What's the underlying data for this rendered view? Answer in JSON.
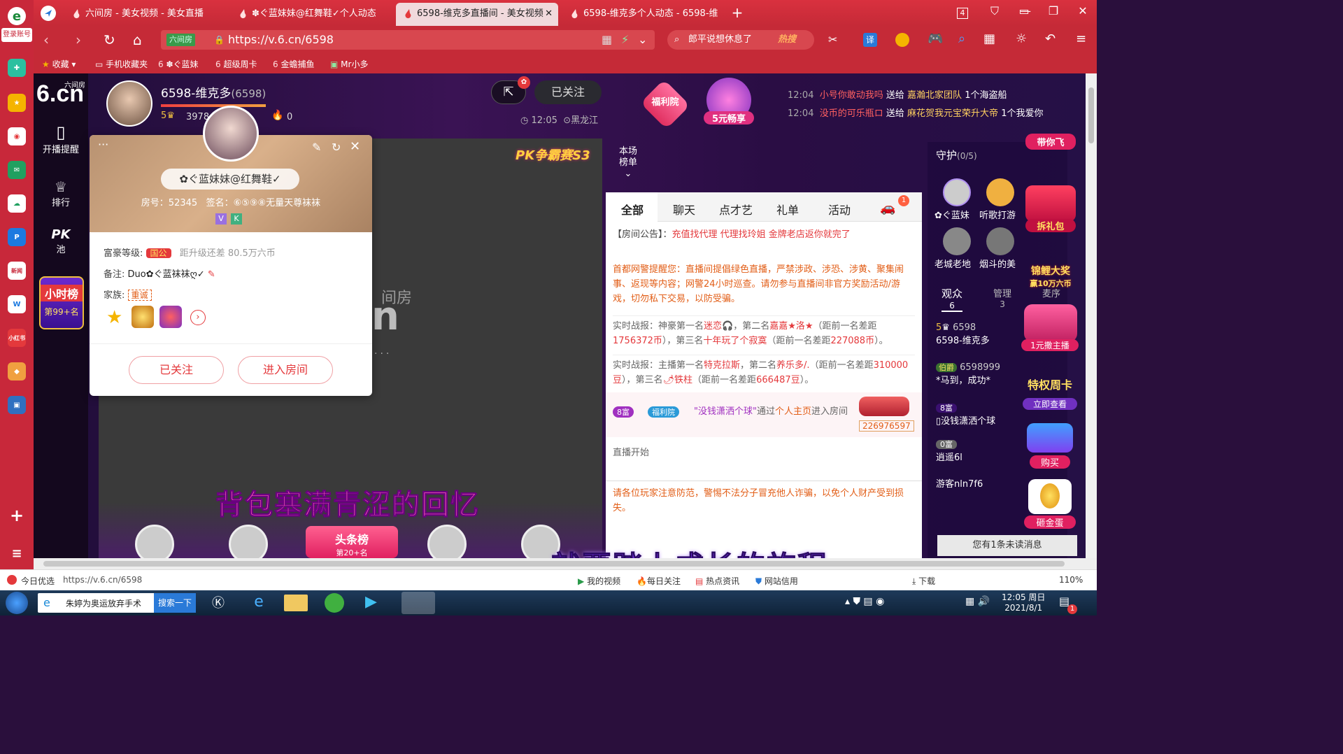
{
  "browser": {
    "login_label": "登录账号",
    "tabs": [
      {
        "title": "六间房 - 美女视频 - 美女直播"
      },
      {
        "title": "✽ぐ蓝妹妹@红舞鞋✓个人动态"
      },
      {
        "title": "6598-维克多直播间 - 美女视频"
      },
      {
        "title": "6598-维克多个人动态 - 6598-维"
      }
    ],
    "tab_count": "4",
    "site_chip": "六间房",
    "url": "https://v.6.cn/6598",
    "search_text": "郎平说想休息了",
    "hot_label": "热搜",
    "translate_label": "译",
    "bookmarks": [
      "收藏",
      "手机收藏夹",
      "✽ぐ蓝妹",
      "超级周卡",
      "金蟾捕鱼",
      "Mr小多"
    ]
  },
  "site": {
    "logo_small": "六间房",
    "logo_big": "6.cn",
    "left_nav": [
      {
        "label": "开播提醒"
      },
      {
        "label": "排行"
      },
      {
        "label": "池"
      }
    ],
    "pk_label": "PK",
    "hour_rank": {
      "title": "小时榜",
      "rank": "第99+名"
    },
    "anchor": {
      "name": "6598-维克多",
      "id": "(6598)",
      "level": "5",
      "fans": "3978",
      "fire": "0",
      "follow_label": "已关注",
      "time": "12:05",
      "location": "黑龙江"
    },
    "promos": {
      "fuli": "福利院",
      "five": "5元畅享"
    },
    "ticker": [
      {
        "time": "12:04",
        "from": "小号你敢动我吗",
        "action": "送给",
        "to": "嘉瀚北家团队",
        "gift": "1个海盗船"
      },
      {
        "time": "12:04",
        "from": "没币的可乐瓶ロ",
        "action": "送给",
        "to": "麻花贺我元宝荣升大帝",
        "gift": "1个我爱你"
      }
    ],
    "pk_banner": "PK争霸赛S3",
    "rank_tag": "本场\n榜单",
    "video": {
      "logo_text_a": "间房",
      "logo_text_b": "n",
      "dots": "...",
      "subtitle": "背包塞满青涩的回忆",
      "top_badge": "头条榜",
      "top_badge_rank": "第20+名"
    },
    "chat_tabs": [
      "全部",
      "聊天",
      "点才艺",
      "礼单",
      "活动"
    ],
    "car_badge": "1",
    "announcement": {
      "label": "【房间公告】：",
      "text": "充值找代理 代理找玲姐 金牌老店返你就完了"
    },
    "police": "首都网警提醒您：直播间提倡绿色直播，严禁涉政、涉恐、涉黄、聚集闹事、返现等内容；网警24小时巡查。请勿参与直播间非官方奖励活动/游戏，切勿私下交易，以防受骗。",
    "report1": {
      "p1": "实时战报：神豪第一名",
      "n1": "迷恋🎧",
      "p2": "，第二名",
      "n2": "嘉嘉★洛★",
      "p3": "（距前一名差距",
      "v1": "1756372币",
      "p4": "），第三名",
      "n3": "十年玩了个寂寞",
      "p5": "（距前一名差距",
      "v2": "227088币",
      "p6": "）。"
    },
    "report2": {
      "p1": "实时战报：主播第一名",
      "n1": "特克拉斯",
      "p2": "，第二名",
      "n2": "养乐多/.",
      "p3": "（距前一名差距",
      "v1": "310000豆",
      "p4": "），第三名",
      "n3": "🌶铁柱",
      "p5": "（距前一名差距",
      "v2": "666487豆",
      "p6": "）。"
    },
    "entry": {
      "level": "8富",
      "badge": "福利院",
      "name": "\"没钱潇洒个球\"",
      "via": "通过",
      "src": "个人主页",
      "action": "进入房间",
      "num": "226976597"
    },
    "live_start": "直播开始",
    "warning": "请各位玩家注意防范，警惕不法分子冒充他人诈骗，以免个人财产受到损失。",
    "guard": {
      "title": "守护",
      "count": "(0/5)",
      "members": [
        "✿ぐ蓝妹",
        "听歌打游",
        "老城老地",
        "烟斗的美"
      ],
      "audience_label": "观众",
      "audience_count": "6",
      "admin_label": "管理",
      "admin_count": "3",
      "mic_label": "麦序",
      "users": [
        {
          "level": "5",
          "id": "6598",
          "name": "6598-维克多"
        },
        {
          "level": "伯爵",
          "id": "6598999",
          "name": "*马到，成功*"
        },
        {
          "level": "8富",
          "name": "没钱潇洒个球"
        },
        {
          "level": "0富",
          "name": "逍遥6l"
        },
        {
          "name": "游客nln7f6"
        }
      ],
      "unread": "您有1条未读消息"
    },
    "right_promos": [
      "带你飞",
      "拆礼包",
      "锦鲤大奖",
      "赢10万六币",
      "1元撒主播",
      "特权周卡",
      "立即查看",
      "购买",
      "砸金蛋"
    ],
    "overlay_sub": "就要踏上成长的旅程"
  },
  "popup": {
    "name": "✿ぐ蓝妹妹@红舞鞋✓",
    "room_label": "房号：52345",
    "sign_label": "签名：⑥⑤⑨⑧无量天尊袜袜",
    "badges": [
      "V",
      "K"
    ],
    "wealth_label": "富豪等级:",
    "wealth_badge": "国公",
    "wealth_next": "距升级还差 80.5万六币",
    "note_label": "备注:",
    "note_value": "Duo✿ぐ蓝袜袜ღ✓",
    "family_label": "家族:",
    "family_value": "重诚",
    "followed_label": "已关注",
    "enter_label": "进入房间",
    "more": "···"
  },
  "statusbar": {
    "left_label": "今日优选",
    "url": "https://v.6.cn/6598",
    "items": [
      "我的视频",
      "每日关注",
      "热点资讯",
      "网站信用"
    ],
    "download": "下载",
    "zoom": "110%"
  },
  "taskbar": {
    "task1": "朱婷为奥运放弃手术",
    "search_btn": "搜索一下",
    "time": "12:05 周日",
    "date": "2021/8/1",
    "notif": "1"
  },
  "colors": {
    "brand_red": "#c8283a",
    "accent_red": "#e4393c",
    "orange": "#e25e17"
  }
}
